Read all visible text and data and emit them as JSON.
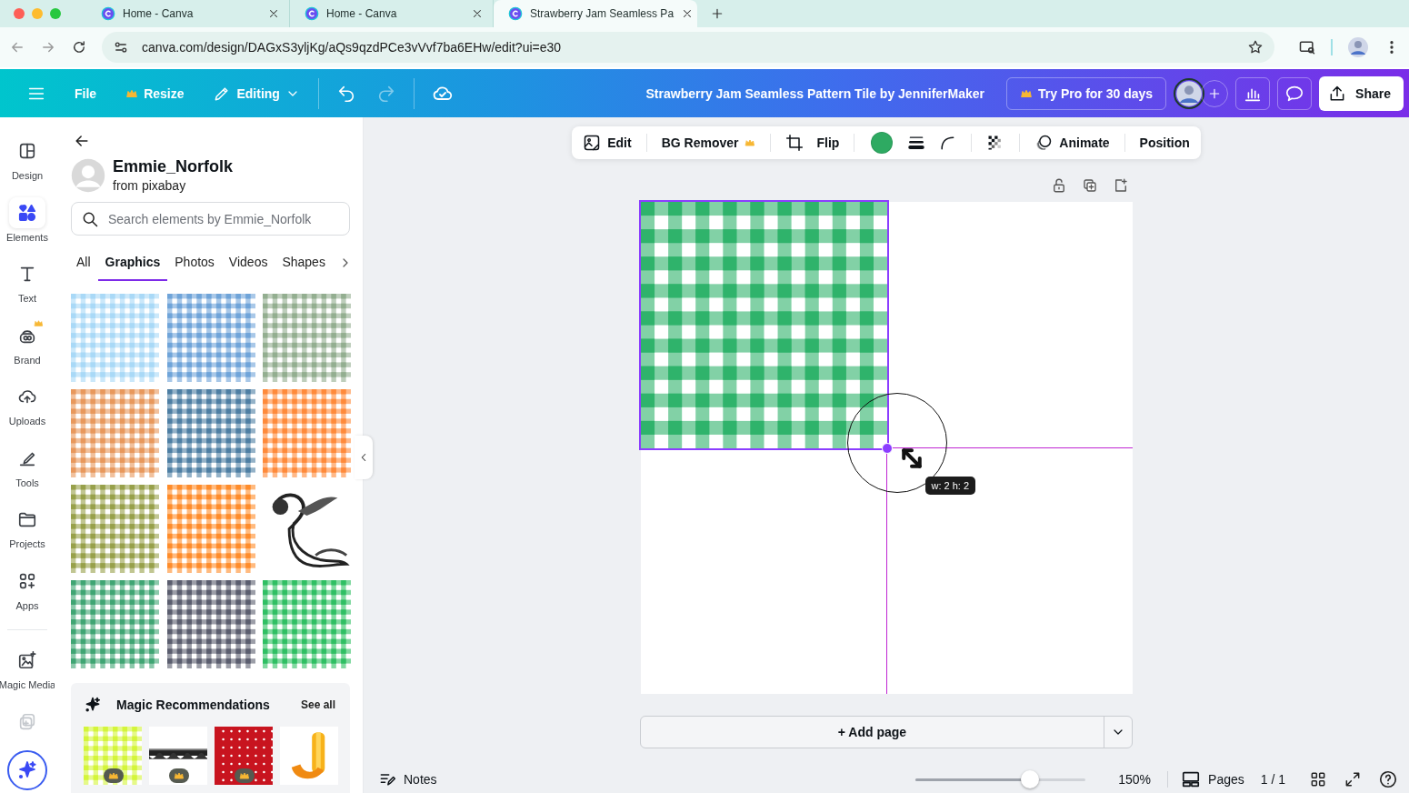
{
  "browser": {
    "tabs": [
      {
        "title": "Home - Canva",
        "selected": false
      },
      {
        "title": "Home - Canva",
        "selected": false
      },
      {
        "title": "Strawberry Jam Seamless Pa",
        "selected": true
      }
    ],
    "url": "canva.com/design/DAGxS3yljKg/aQs9qzdPCe3vVvf7ba6EHw/edit?ui=e30"
  },
  "header": {
    "file": "File",
    "resize": "Resize",
    "mode": "Editing",
    "title": "Strawberry Jam Seamless Pattern Tile by JenniferMaker",
    "pro": "Try Pro for 30 days",
    "share": "Share"
  },
  "rail": [
    {
      "label": "Design",
      "selected": false
    },
    {
      "label": "Elements",
      "selected": true
    },
    {
      "label": "Text",
      "selected": false
    },
    {
      "label": "Brand",
      "selected": false
    },
    {
      "label": "Uploads",
      "selected": false
    },
    {
      "label": "Tools",
      "selected": false
    },
    {
      "label": "Projects",
      "selected": false
    },
    {
      "label": "Apps",
      "selected": false
    },
    {
      "label": "Magic Media",
      "selected": false
    }
  ],
  "panel": {
    "creator": "Emmie_Norfolk",
    "source": "from pixabay",
    "search_placeholder": "Search elements by Emmie_Norfolk",
    "tabs": [
      {
        "label": "All",
        "selected": false
      },
      {
        "label": "Graphics",
        "selected": true
      },
      {
        "label": "Photos",
        "selected": false
      },
      {
        "label": "Videos",
        "selected": false
      },
      {
        "label": "Shapes",
        "selected": false
      }
    ],
    "items": [
      {
        "kind": "gingham",
        "color": "#a9d9f7"
      },
      {
        "kind": "gingham",
        "color": "#6fa4d9"
      },
      {
        "kind": "gingham",
        "color": "#93ae90"
      },
      {
        "kind": "gingham",
        "color": "#e8985c"
      },
      {
        "kind": "gingham",
        "color": "#4d7ea3"
      },
      {
        "kind": "gingham",
        "color": "#ff8a3a"
      },
      {
        "kind": "gingham",
        "color": "#97a04a"
      },
      {
        "kind": "gingham",
        "color": "#ff8c2a"
      },
      {
        "kind": "picture"
      },
      {
        "kind": "gingham",
        "color": "#3fa573"
      },
      {
        "kind": "gingham",
        "color": "#5a5d6e"
      },
      {
        "kind": "gingham",
        "color": "#2fbf63"
      }
    ],
    "recommendations": {
      "title": "Magic Recommendations",
      "link": "See all",
      "items": [
        {
          "kind": "gingham",
          "color": "#d4f53a"
        },
        {
          "kind": "picture"
        },
        {
          "kind": "picture"
        },
        {
          "kind": "picture"
        }
      ]
    }
  },
  "toolbar": {
    "edit": "Edit",
    "bg_remover": "BG Remover",
    "flip": "Flip",
    "fill": {
      "color": "#2eaa62"
    },
    "animate": "Animate",
    "position": "Position"
  },
  "canvas": {
    "image": {
      "kind": "gingham",
      "color": "#2fb36b"
    },
    "size_tooltip": "w: 2 h: 2",
    "add_page": "+ Add page"
  },
  "footer": {
    "notes": "Notes",
    "zoom_slider": {
      "level": 0.67
    },
    "zoom": "150%",
    "pages": "Pages",
    "page_count": "1 / 1"
  }
}
